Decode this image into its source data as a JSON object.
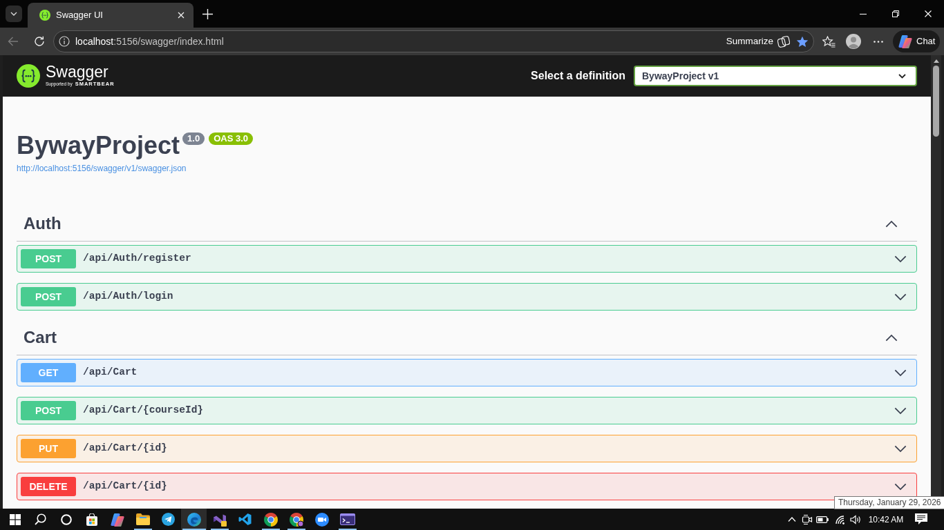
{
  "browser": {
    "tabs": [
      {
        "title": "Swagger UI",
        "selected": true
      }
    ],
    "address": {
      "host": "localhost",
      "path": ":5156/swagger/index.html"
    },
    "summarize": "Summarize",
    "favorited": true,
    "chat": "Chat"
  },
  "topbar": {
    "brand": "Swagger",
    "tagline": "Supported by",
    "company": "SMARTBEAR",
    "definition_label": "Select a definition",
    "definition": "BywayProject v1"
  },
  "info": {
    "title": "BywayProject",
    "version": "1.0",
    "spec": "OAS 3.0",
    "url": "http://localhost:5156/swagger/v1/swagger.json"
  },
  "sections": [
    {
      "name": "Auth",
      "expanded": true,
      "operations": [
        {
          "kind": "post",
          "method": "POST",
          "path": "/api/Auth/register",
          "expanded": false
        },
        {
          "kind": "post",
          "method": "POST",
          "path": "/api/Auth/login",
          "expanded": false
        }
      ]
    },
    {
      "name": "Cart",
      "expanded": true,
      "operations": [
        {
          "kind": "get",
          "method": "GET",
          "path": "/api/Cart",
          "expanded": false
        },
        {
          "kind": "post",
          "method": "POST",
          "path": "/api/Cart/{courseId}",
          "expanded": false
        },
        {
          "kind": "put",
          "method": "PUT",
          "path": "/api/Cart/{id}",
          "expanded": false
        },
        {
          "kind": "delete",
          "method": "DELETE",
          "path": "/api/Cart/{id}",
          "expanded": false
        }
      ]
    }
  ],
  "taskbar": {
    "apps": [
      {
        "kind": "start",
        "running": false,
        "selected": false
      },
      {
        "kind": "search",
        "running": false,
        "selected": false
      },
      {
        "kind": "cortana",
        "running": false,
        "selected": false
      },
      {
        "kind": "store",
        "running": false,
        "selected": false
      },
      {
        "kind": "copilot",
        "running": false,
        "selected": false
      },
      {
        "kind": "explorer",
        "running": true,
        "selected": false
      },
      {
        "kind": "telegram",
        "running": false,
        "selected": false
      },
      {
        "kind": "edge",
        "running": true,
        "selected": true
      },
      {
        "kind": "studio",
        "running": true,
        "selected": false
      },
      {
        "kind": "code",
        "running": false,
        "selected": false
      },
      {
        "kind": "chrome",
        "running": true,
        "selected": false
      },
      {
        "kind": "chrome",
        "running": true,
        "selected": false
      },
      {
        "kind": "zoom",
        "running": false,
        "selected": false
      },
      {
        "kind": "terminal",
        "running": true,
        "selected": false
      }
    ],
    "time": "10:42 AM",
    "tooltip": "Thursday, January 29, 2026"
  }
}
